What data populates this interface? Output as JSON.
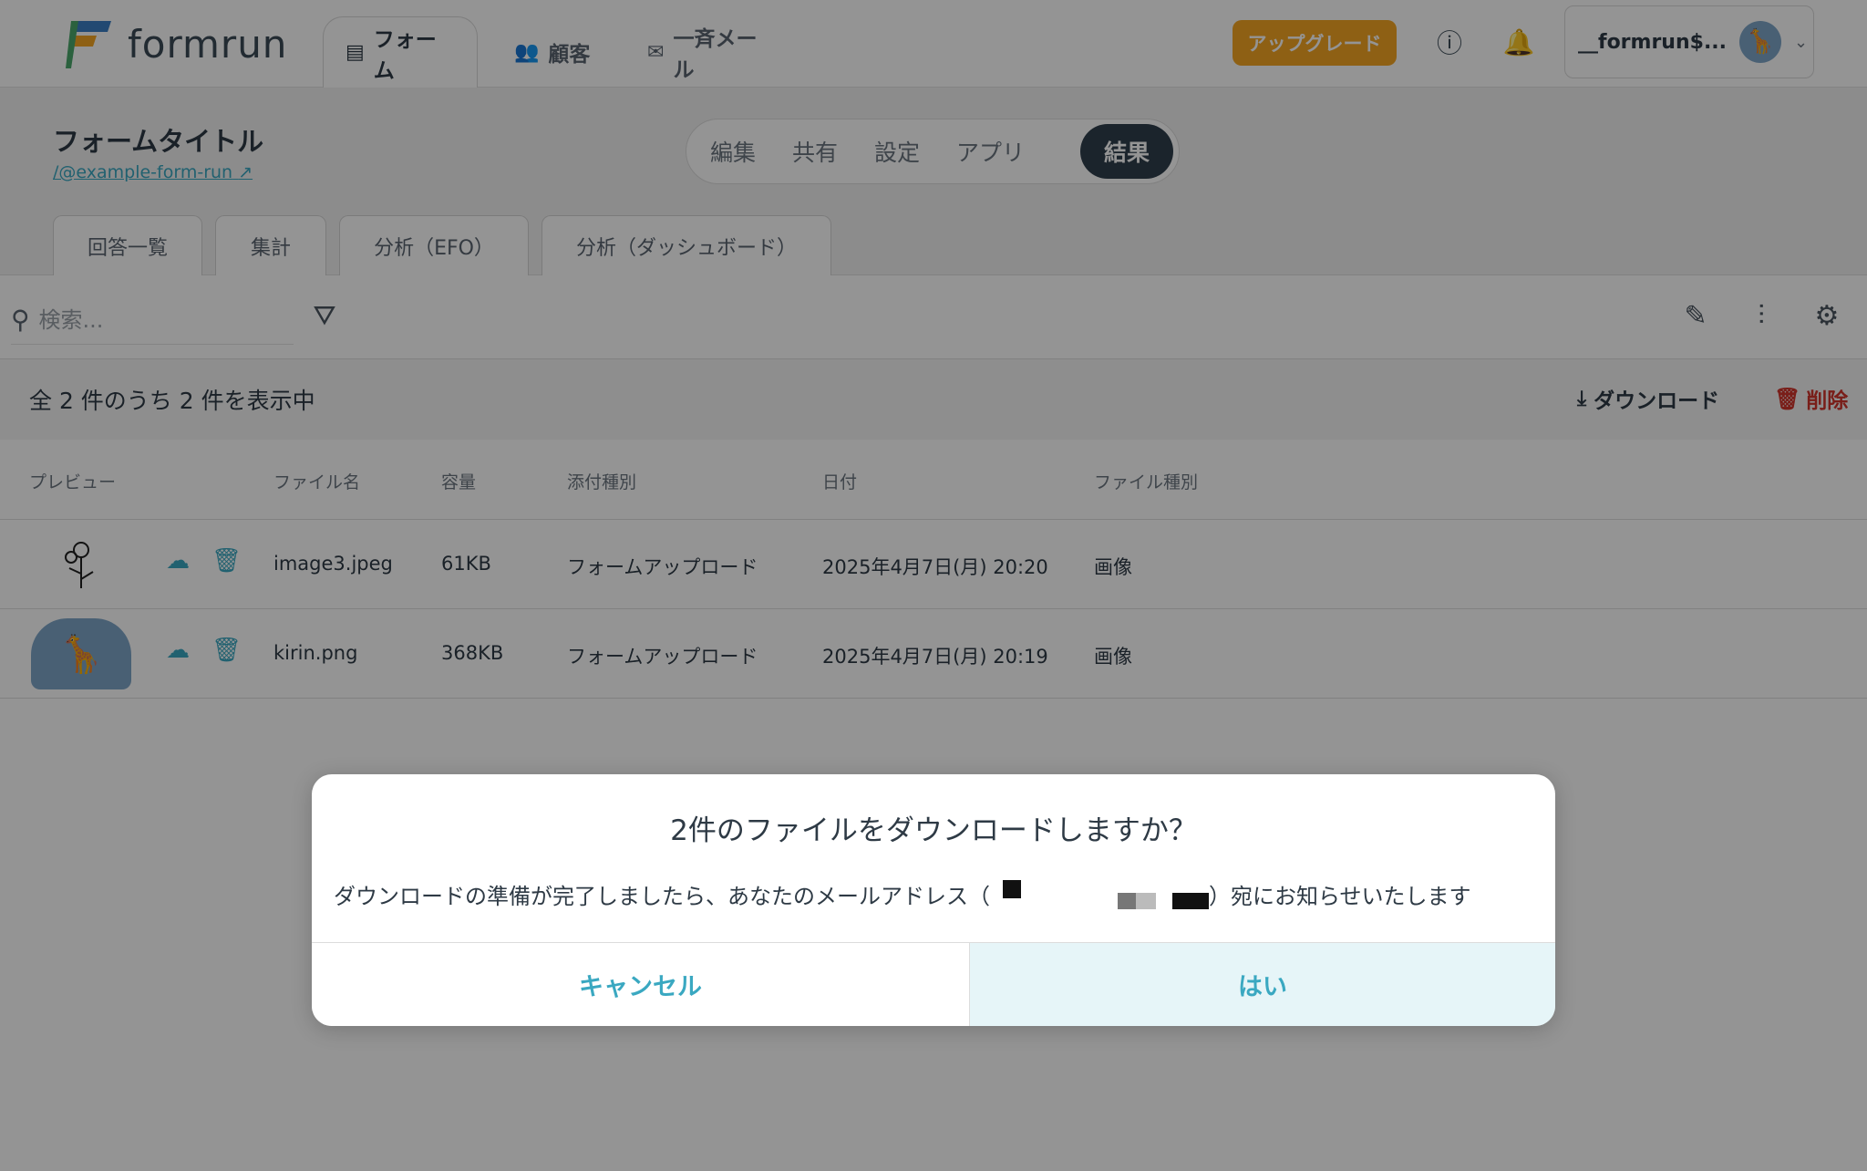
{
  "header": {
    "logo_text": "formrun",
    "nav": [
      {
        "label": "フォーム",
        "icon": "form-icon"
      },
      {
        "label": "顧客",
        "icon": "people-icon"
      },
      {
        "label": "一斉メール",
        "icon": "mail-icon"
      }
    ],
    "upgrade_label": "アップグレード",
    "user_name": "__formrun$..."
  },
  "form": {
    "title": "フォームタイトル",
    "link": "/@example-form-run",
    "mode_tabs": [
      "編集",
      "共有",
      "設定",
      "アプリ",
      "結果"
    ],
    "result_tabs": [
      "回答一覧",
      "集計",
      "分析（EFO）",
      "分析（ダッシュボード）"
    ]
  },
  "toolbar": {
    "search_placeholder": "検索..."
  },
  "countbar": {
    "count_text": "全 2 件のうち 2 件を表示中",
    "download_label": "ダウンロード",
    "delete_label": "削除"
  },
  "table": {
    "headers": [
      "プレビュー",
      "ファイル名",
      "容量",
      "添付種別",
      "日付",
      "ファイル種別"
    ],
    "rows": [
      {
        "filename": "image3.jpeg",
        "size": "61KB",
        "attach_type": "フォームアップロード",
        "date": "2025年4月7日(月) 20:20",
        "file_type": "画像"
      },
      {
        "filename": "kirin.png",
        "size": "368KB",
        "attach_type": "フォームアップロード",
        "date": "2025年4月7日(月) 20:19",
        "file_type": "画像"
      }
    ]
  },
  "modal": {
    "title": "2件のファイルをダウンロードしますか？",
    "body_prefix": "ダウンロードの準備が完了しましたら、あなたのメールアドレス（",
    "body_suffix": "）宛にお知らせいたします",
    "cancel_label": "キャンセル",
    "confirm_label": "はい"
  },
  "colors": {
    "accent": "#3aa8c1",
    "upgrade": "#f5a623",
    "danger": "#d0342c",
    "dark": "#2f3f4c"
  }
}
